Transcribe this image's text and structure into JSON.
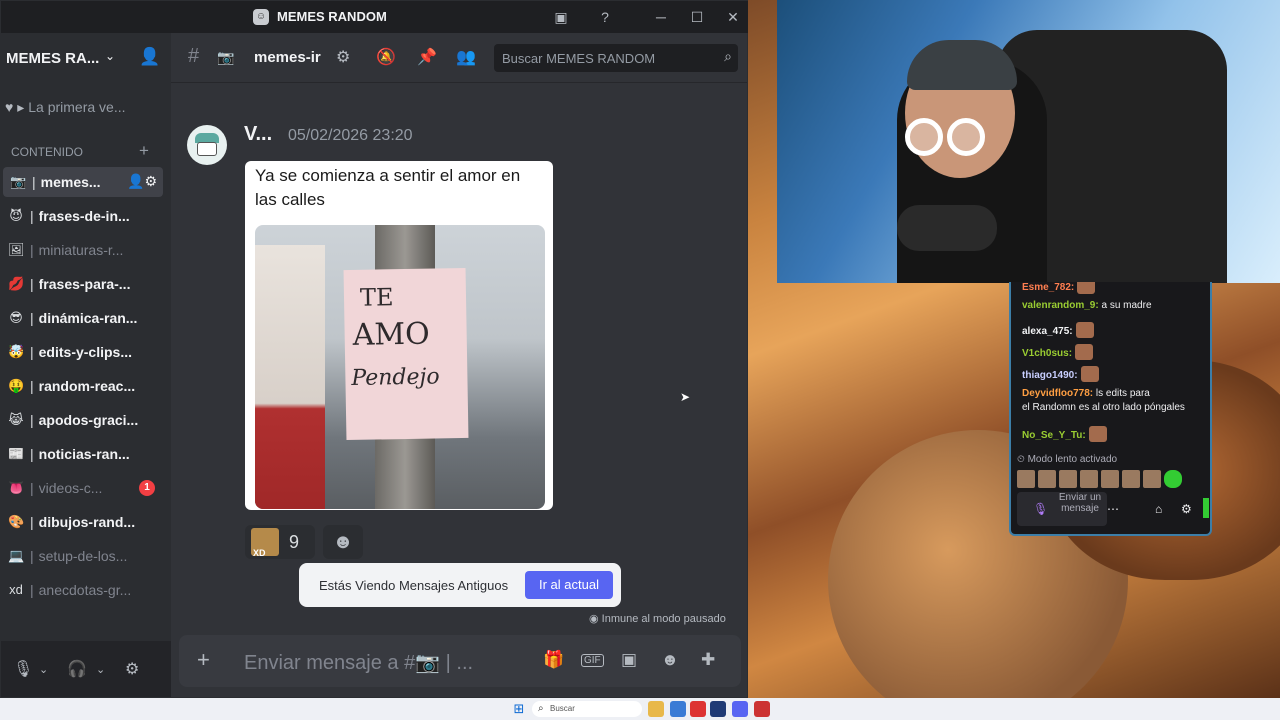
{
  "window": {
    "title": "MEMES RANDOM",
    "controls": [
      "─",
      "☐",
      "✕"
    ]
  },
  "server": {
    "name": "MEMES RA...",
    "event_label": "La primera ve...",
    "category": "CONTENIDO",
    "channels": [
      {
        "emoji": "📷",
        "name": "memes...",
        "active": true,
        "muted": false,
        "icons": "👤⚙",
        "badge": ""
      },
      {
        "emoji": "😈",
        "name": "frases-de-in...",
        "active": false,
        "muted": false,
        "icons": "",
        "badge": ""
      },
      {
        "emoji": "🖼",
        "name": "miniaturas-r...",
        "active": false,
        "muted": true,
        "icons": "",
        "badge": ""
      },
      {
        "emoji": "💋",
        "name": "frases-para-...",
        "active": false,
        "muted": false,
        "icons": "",
        "badge": ""
      },
      {
        "emoji": "😎",
        "name": "dinámica-ran...",
        "active": false,
        "muted": false,
        "icons": "",
        "badge": ""
      },
      {
        "emoji": "🤯",
        "name": "edits-y-clips...",
        "active": false,
        "muted": false,
        "icons": "",
        "badge": ""
      },
      {
        "emoji": "🤑",
        "name": "random-reac...",
        "active": false,
        "muted": false,
        "icons": "",
        "badge": ""
      },
      {
        "emoji": "😹",
        "name": "apodos-graci...",
        "active": false,
        "muted": false,
        "icons": "",
        "badge": ""
      },
      {
        "emoji": "📰",
        "name": "noticias-ran...",
        "active": false,
        "muted": false,
        "icons": "",
        "badge": ""
      },
      {
        "emoji": "👅",
        "name": "videos-c...",
        "active": false,
        "muted": true,
        "icons": "",
        "badge": "1"
      },
      {
        "emoji": "🎨",
        "name": "dibujos-rand...",
        "active": false,
        "muted": false,
        "icons": "",
        "badge": ""
      },
      {
        "emoji": "💻",
        "name": "setup-de-los...",
        "active": false,
        "muted": true,
        "icons": "",
        "badge": ""
      },
      {
        "emoji": "xd",
        "name": "anecdotas-gr...",
        "active": false,
        "muted": true,
        "icons": "",
        "badge": ""
      }
    ]
  },
  "channel_header": {
    "name": "memes-ir",
    "search_placeholder": "Buscar MEMES RANDOM"
  },
  "message": {
    "author": "V...",
    "timestamp": "05/02/2026 23:20",
    "caption": "Ya se comienza a sentir el amor en las calles",
    "sign_lines": [
      "TE",
      "AMO",
      "Pendejo"
    ],
    "reaction_count": "9",
    "reaction_emoji_text": "XD"
  },
  "banner": {
    "text": "Estás Viendo Mensajes Antiguos",
    "button": "Ir al actual",
    "paused_text": "Inmune al modo pausado"
  },
  "composer": {
    "placeholder": "Enviar mensaje a #📷 | ...",
    "icons": [
      "gift-icon",
      "gif-icon",
      "sticker-icon",
      "emoji-icon",
      "apps-icon"
    ]
  },
  "twitch_chat": {
    "lines": [
      {
        "user": "Esme_782:",
        "text": "",
        "color": "#ff7f50",
        "emote": true
      },
      {
        "user": "valenrandom_9:",
        "text": " a su madre",
        "color": "#9acd32",
        "emote": false
      },
      {
        "user": "alexa_475:",
        "text": "",
        "color": "#f2f3f5",
        "emote": true
      },
      {
        "user": "V1ch0sus:",
        "text": "",
        "color": "#9acd32",
        "emote": true
      },
      {
        "user": "thiago1490:",
        "text": "",
        "color": "#c9cfff",
        "emote": true
      },
      {
        "user": "Deyvidfloo778:",
        "text": " ls edits para",
        "color": "#ff9f43",
        "emote": false
      },
      {
        "user": "",
        "text": "el Randomn es al otro lado póngales",
        "color": "#efeff1",
        "emote": false
      },
      {
        "user": "No_Se_Y_Tu:",
        "text": "",
        "color": "#9acd32",
        "emote": true
      }
    ],
    "slow_mode": "Modo lento activado",
    "send_placeholder": "Enviar un mensaje"
  },
  "taskbar": {
    "search": "Buscar"
  },
  "colors": {
    "accent": "#5865f2",
    "danger": "#f23f43"
  }
}
